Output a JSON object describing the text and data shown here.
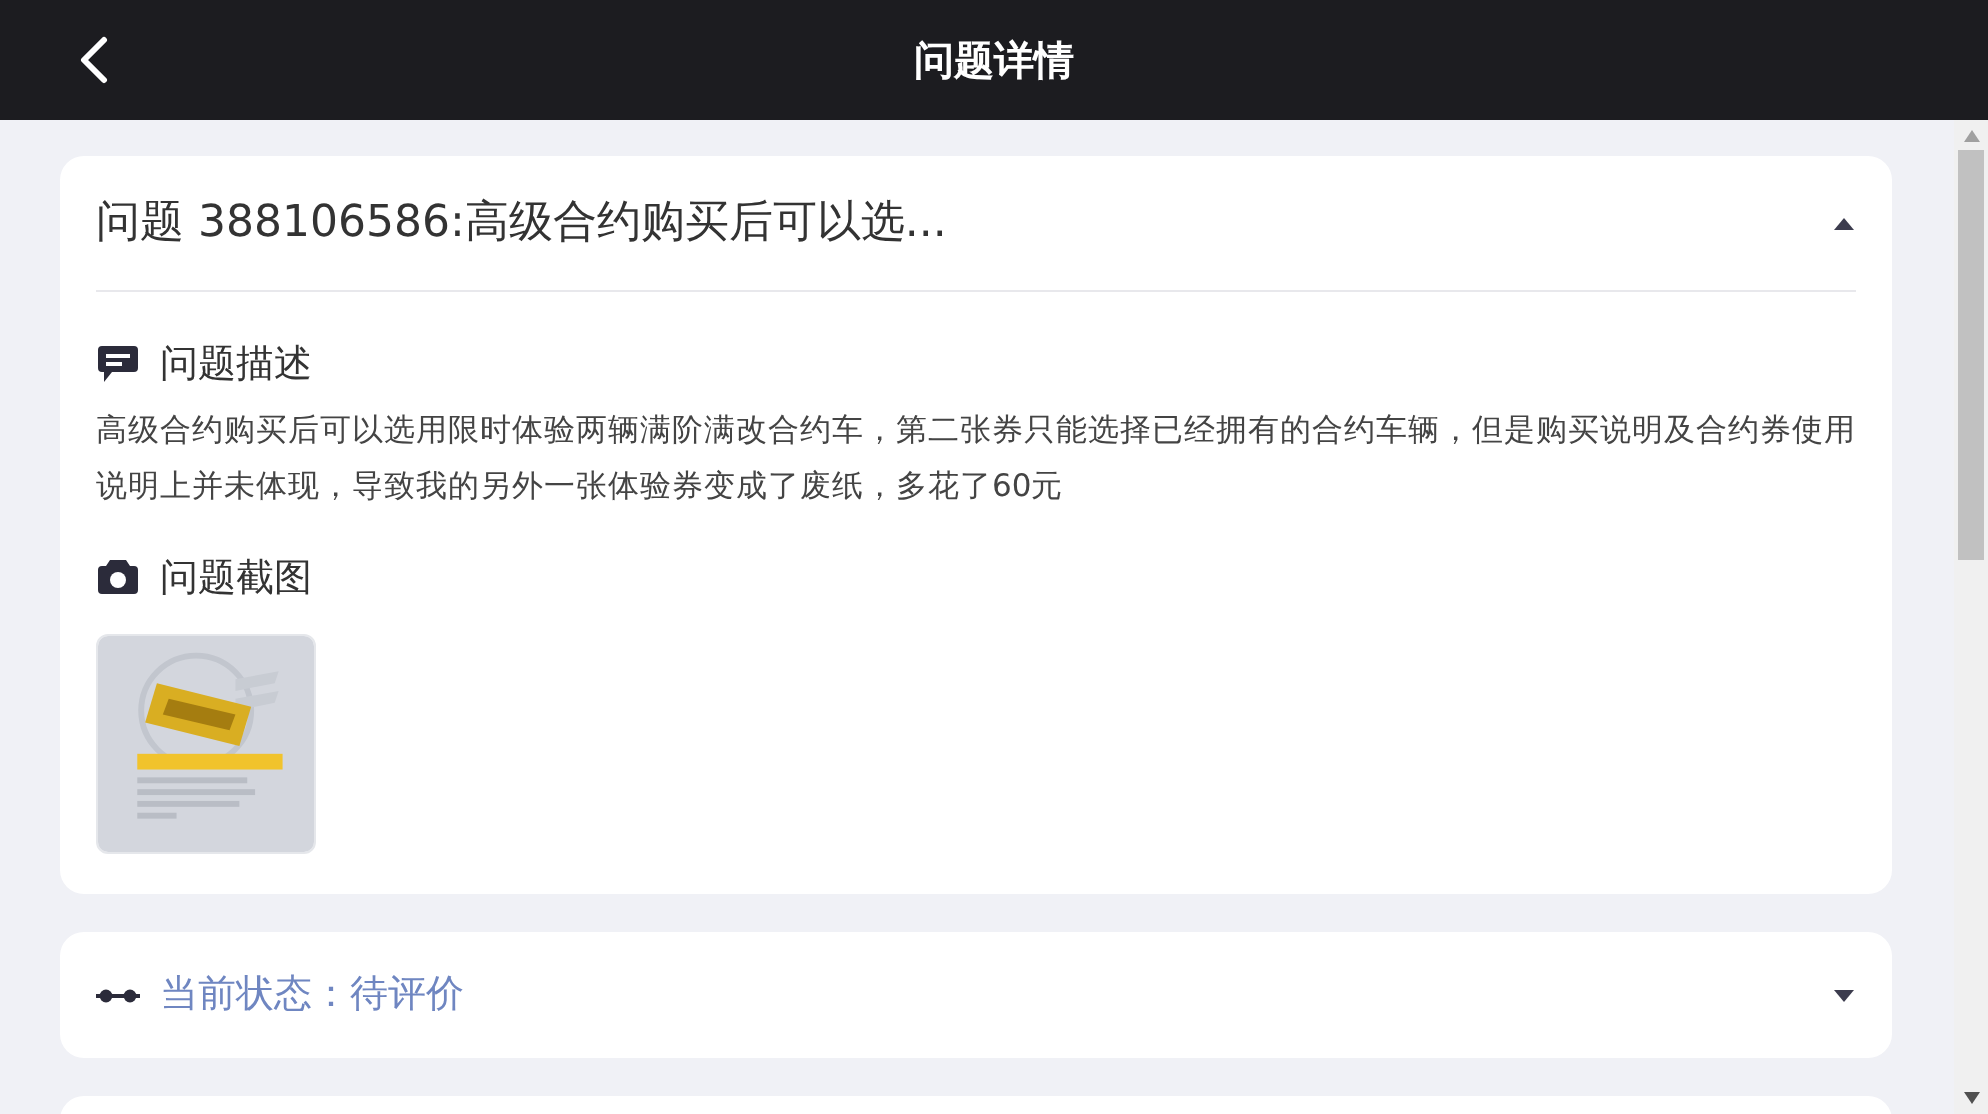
{
  "header": {
    "title": "问题详情"
  },
  "problem": {
    "title": "问题 388106586:高级合约购买后可以选...",
    "expanded": true,
    "description": {
      "label": "问题描述",
      "text": "高级合约购买后可以选用限时体验两辆满阶满改合约车，第二张券只能选择已经拥有的合约车辆，但是购买说明及合约券使用说明上并未体现，导致我的另外一张体验券变成了废纸，多花了60元"
    },
    "screenshots": {
      "label": "问题截图"
    }
  },
  "status": {
    "label": "当前状态：待评价",
    "expanded": false
  }
}
